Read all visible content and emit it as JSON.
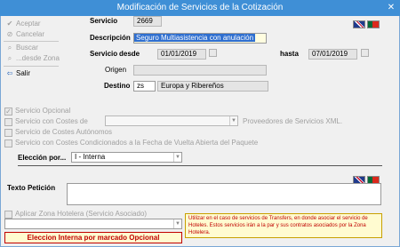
{
  "window": {
    "title": "Modificación de Servicios de la Cotización"
  },
  "sidebar": {
    "items": [
      {
        "label": "Aceptar",
        "icon": "check-icon",
        "enabled": false
      },
      {
        "label": "Cancelar",
        "icon": "cancel-icon",
        "enabled": false
      },
      {
        "label": "Buscar",
        "icon": "search-icon",
        "enabled": false
      },
      {
        "label": "...desde Zona",
        "icon": "zone-icon",
        "enabled": false
      },
      {
        "label": "Salir",
        "icon": "exit-icon",
        "enabled": true
      }
    ]
  },
  "form": {
    "servicio_label": "Servicio",
    "servicio_value": "2669",
    "descripcion_label": "Descripción",
    "descripcion_value": "Seguro Multiasistencia con anulación",
    "servicio_desde_label": "Servicio",
    "desde_label": "desde",
    "desde_value": "01/01/2019",
    "hasta_label": "hasta",
    "hasta_value": "07/01/2019",
    "origen_label": "Origen",
    "origen_value": "",
    "destino_label": "Destino",
    "destino_code": "zs",
    "destino_value": "Europa y Ribereños"
  },
  "options": {
    "servicio_opcional": "Servicio Opcional",
    "servicio_con_costes": "Servicio con Costes de",
    "proveedores": "Proveedores de Servicios XML.",
    "costes_autonomos": "Servicio de Costes Autónomos",
    "costes_condicionados": "Servicio con Costes Condicionados a la Fecha de Vuelta Abierta del Paquete",
    "eleccion_label": "Elección por...",
    "eleccion_value": "I - Interna"
  },
  "peticion": {
    "label": "Texto Petición",
    "value": ""
  },
  "zona": {
    "label": "Aplicar Zona Hotelera (Servicio Asociado)",
    "note": "Utilizar en el caso de servicios de Transfers, en donde asociar el servicio de Hoteles. Estos servicios irán a la par y sus contratos asociados por la Zona Hotelera.",
    "status": "Eleccion Interna por marcado Opcional"
  },
  "colors": {
    "titlebar": "#3f8fd6",
    "selection": "#2f6fd0",
    "warning_text": "#c00000",
    "note_bg": "#fffbd0"
  }
}
